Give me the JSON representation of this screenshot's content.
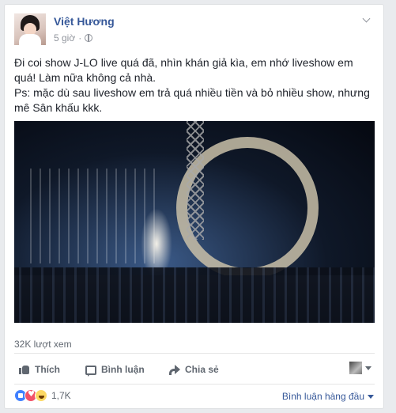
{
  "post": {
    "author": "Việt Hương",
    "time": "5 giờ",
    "privacy_icon": "globe-icon",
    "text_line1": "Đi coi show J-LO live quá đã, nhìn khán giả kìa, em nhớ liveshow em quá! Làm nữa không cả nhà.",
    "text_line2": "Ps: mặc dù sau liveshow em trả quá nhiều tiền và bỏ nhiều show, nhưng mê Sân khấu kkk.",
    "views": "32K lượt xem"
  },
  "actions": {
    "like": "Thích",
    "comment": "Bình luận",
    "share": "Chia sẻ"
  },
  "reactions": {
    "count": "1,7K",
    "sort_label": "Bình luận hàng đầu"
  },
  "colors": {
    "link": "#365899",
    "muted": "#606770",
    "like": "#4080ff",
    "love": "#f25268",
    "haha": "#fcd863"
  }
}
